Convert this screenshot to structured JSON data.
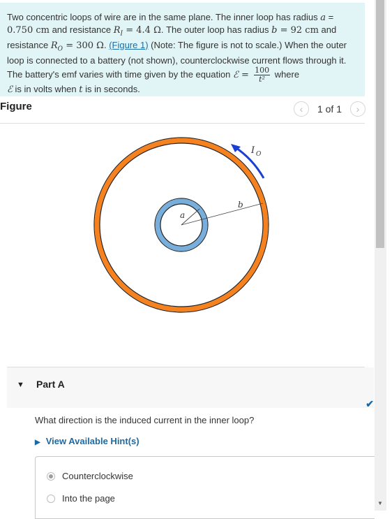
{
  "problem": {
    "line1": "Two concentric loops of wire are in the same plane.  The inner loop has radius ",
    "a_var": "a",
    "eq1": " = ",
    "a_value": "0.750 cm",
    "line2a": " and resistance ",
    "RI": "R",
    "RI_sub": "I",
    "RI_value": " = 4.4 Ω",
    "line2b": ".  The outer loop has radius ",
    "b_var": "b",
    "b_value": " = 92 cm",
    "line2c": " and resistance ",
    "RO": "R",
    "RO_sub": "O",
    "RO_value": " = 300 Ω",
    "line3a": ". ",
    "figure_link": "(Figure 1)",
    "line3b": " (Note:  The figure is not to scale.)  When the outer loop is connected to a battery (not shown), counterclockwise current flows through it.  The battery's emf varies with time given by the equation ",
    "emf_symbol": "ℰ",
    "emf_eq": " = ",
    "frac_num": "100",
    "frac_den": "t²",
    "line4a": " where ",
    "line4b": " is in volts when ",
    "t_var": "t",
    "line4c": " is in seconds."
  },
  "figure": {
    "title": "Figure",
    "pager_text": "1 of 1",
    "prev_icon": "chevron-left-icon",
    "next_icon": "chevron-right-icon",
    "label_a": "a",
    "label_b": "b",
    "label_current": "I",
    "label_current_sub": "O",
    "colors": {
      "outer_loop": "#f5821f",
      "inner_loop": "#78aedb",
      "arrow": "#1a3fd6"
    }
  },
  "part": {
    "title": "Part A",
    "status_icon": "checkmark-icon",
    "question": "What direction is the induced current in the inner loop?",
    "hints_label": "View Available Hint(s)",
    "options": [
      {
        "label": "Counterclockwise",
        "selected": true
      },
      {
        "label": "Into the page",
        "selected": false
      }
    ]
  }
}
